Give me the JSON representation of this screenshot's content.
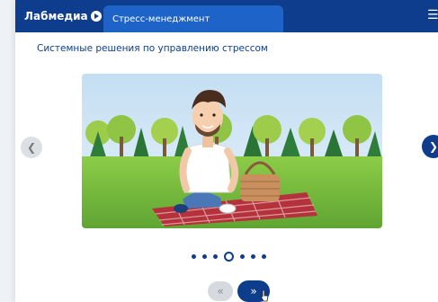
{
  "header": {
    "brand": "Лабмедиа",
    "course_title": "Стресс-менеджмент",
    "menu_icon": "hamburger-icon"
  },
  "slide": {
    "subtitle": "Системные решения по управлению стрессом",
    "illustration": "man-on-picnic-blanket-in-park"
  },
  "carousel": {
    "prev_icon": "chevron-left-icon",
    "next_icon": "chevron-right-icon",
    "dots_total": 7,
    "active_dot": 4
  },
  "pager": {
    "prev_icon": "double-chevron-left-icon",
    "next_icon": "double-chevron-right-icon"
  },
  "colors": {
    "primary": "#0d3d8c",
    "tab": "#1e64c8",
    "sky": "#cfe5f5",
    "grass": "#7fc241",
    "blanket": "#b5313b"
  }
}
